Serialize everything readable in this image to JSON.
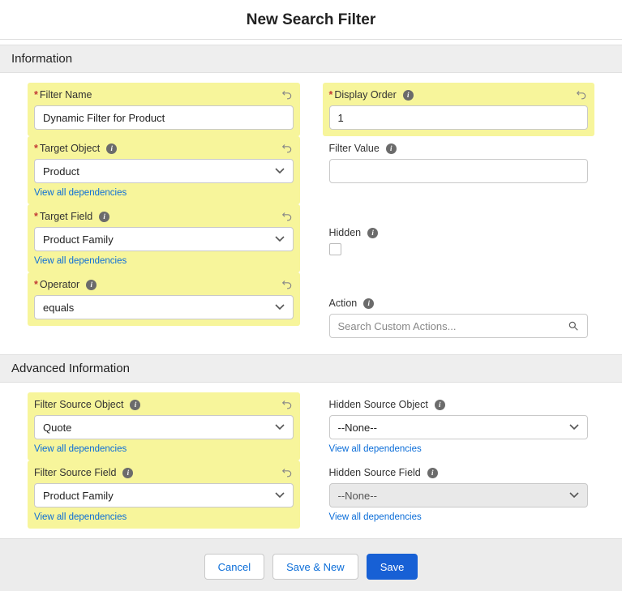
{
  "pageTitle": "New Search Filter",
  "sections": {
    "information": "Information",
    "advanced": "Advanced Information"
  },
  "left": {
    "filterName": {
      "label": "Filter Name",
      "value": "Dynamic Filter for Product"
    },
    "targetObject": {
      "label": "Target Object",
      "value": "Product",
      "depLink": "View all dependencies"
    },
    "targetField": {
      "label": "Target Field",
      "value": "Product Family",
      "depLink": "View all dependencies"
    },
    "operator": {
      "label": "Operator",
      "value": "equals"
    },
    "filterSourceObject": {
      "label": "Filter Source Object",
      "value": "Quote",
      "depLink": "View all dependencies"
    },
    "filterSourceField": {
      "label": "Filter Source Field",
      "value": "Product Family",
      "depLink": "View all dependencies"
    }
  },
  "right": {
    "displayOrder": {
      "label": "Display Order",
      "value": "1"
    },
    "filterValue": {
      "label": "Filter Value",
      "value": ""
    },
    "hidden": {
      "label": "Hidden"
    },
    "action": {
      "label": "Action",
      "placeholder": "Search Custom Actions..."
    },
    "hiddenSourceObject": {
      "label": "Hidden Source Object",
      "value": "--None--",
      "depLink": "View all dependencies"
    },
    "hiddenSourceField": {
      "label": "Hidden Source Field",
      "value": "--None--",
      "depLink": "View all dependencies"
    }
  },
  "footer": {
    "cancel": "Cancel",
    "saveNew": "Save & New",
    "save": "Save"
  }
}
